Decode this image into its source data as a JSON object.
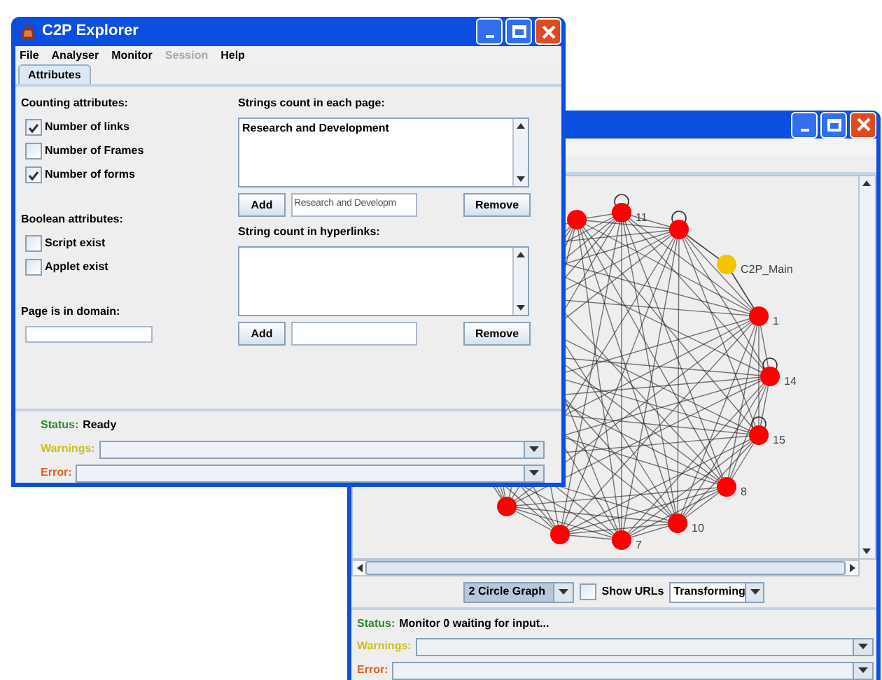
{
  "explorer_window": {
    "title": "C2P Explorer",
    "menu": [
      {
        "label": "File",
        "disabled": false
      },
      {
        "label": "Analyser",
        "disabled": false
      },
      {
        "label": "Monitor",
        "disabled": false
      },
      {
        "label": "Session",
        "disabled": true
      },
      {
        "label": "Help",
        "disabled": false
      }
    ],
    "tabs": [
      {
        "label": "Attributes",
        "selected": true
      }
    ],
    "counting": {
      "heading": "Counting attributes:",
      "items": [
        {
          "label": "Number of links",
          "checked": true
        },
        {
          "label": "Number of Frames",
          "checked": false
        },
        {
          "label": "Number of forms",
          "checked": true
        }
      ]
    },
    "boolean": {
      "heading": "Boolean attributes:",
      "items": [
        {
          "label": "Script exist",
          "checked": false
        },
        {
          "label": "Applet exist",
          "checked": false
        }
      ]
    },
    "domain": {
      "heading": "Page is in domain:"
    },
    "page_strings": {
      "heading": "Strings count in each page:",
      "list": [
        "Research and Development"
      ],
      "add": "Add",
      "input_value": "Research and Developm",
      "remove": "Remove"
    },
    "link_strings": {
      "heading": "String count in hyperlinks:",
      "add": "Add",
      "remove": "Remove"
    },
    "status": {
      "label": "Status:",
      "text": "Ready"
    },
    "warnings": {
      "label": "Warnings:"
    },
    "error": {
      "label": "Error:"
    }
  },
  "monitor_window": {
    "graph": {
      "nodes": [
        {
          "color": "#ff0000"
        },
        {
          "label": "11",
          "color": "#ff0000"
        },
        {
          "color": "#ff0000"
        },
        {
          "label": "C2P_Main",
          "color": "#f5c400"
        },
        {
          "label": "1",
          "color": "#ff0000"
        },
        {
          "label": "14",
          "color": "#ff0000"
        },
        {
          "label": "15",
          "color": "#ff0000"
        },
        {
          "label": "8",
          "color": "#ff0000"
        },
        {
          "label": "10",
          "color": "#ff0000"
        },
        {
          "label": "7",
          "color": "#ff0000"
        },
        {
          "color": "#ff0000"
        },
        {
          "color": "#ff0000"
        }
      ]
    },
    "layout_select": {
      "value": "2 Circle Graph"
    },
    "show_urls": {
      "label": "Show URLs",
      "checked": false
    },
    "mode_select": {
      "value": "Transforming"
    },
    "status": {
      "label": "Status:",
      "text": "Monitor 0 waiting for input..."
    },
    "warnings": {
      "label": "Warnings:"
    },
    "error": {
      "label": "Error:"
    }
  }
}
